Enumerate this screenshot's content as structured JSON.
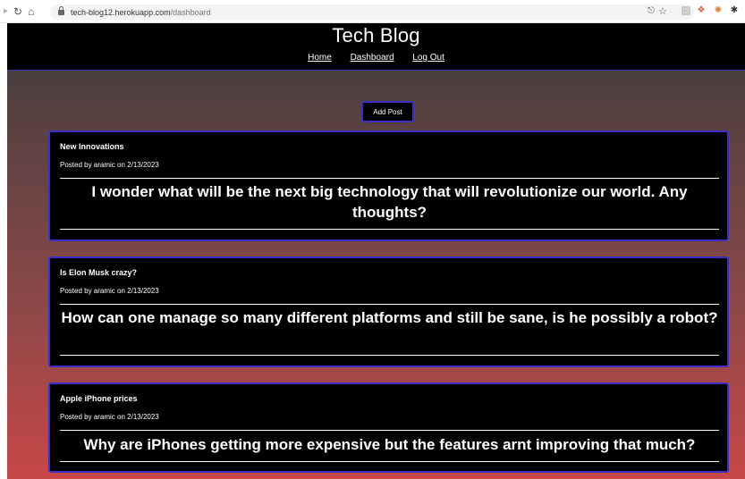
{
  "browser": {
    "url_host": "tech-blog12.herokuapp.com",
    "url_path": "/dashboard"
  },
  "header": {
    "title": "Tech Blog",
    "nav": [
      "Home",
      "Dashboard",
      "Log Out"
    ]
  },
  "add_post_label": "Add Post",
  "posts": [
    {
      "title": "New Innovations",
      "meta": "Posted by aramic on 2/13/2023",
      "body": "I wonder what will be the next big technology that will revolutionize our world. Any thoughts?"
    },
    {
      "title": "Is Elon Musk crazy?",
      "meta": "Posted by aramic on 2/13/2023",
      "body": "How can one manage so many different platforms and still be sane, is he possibly a robot?"
    },
    {
      "title": "Apple iPhone prices",
      "meta": "Posted by aramic on 2/13/2023",
      "body": "Why are iPhones getting more expensive but the features arnt improving that much?"
    }
  ],
  "colors": {
    "accent_border": "#3b2ec4",
    "gradient_top": "#3d3d3d",
    "gradient_bottom": "#c84747"
  }
}
